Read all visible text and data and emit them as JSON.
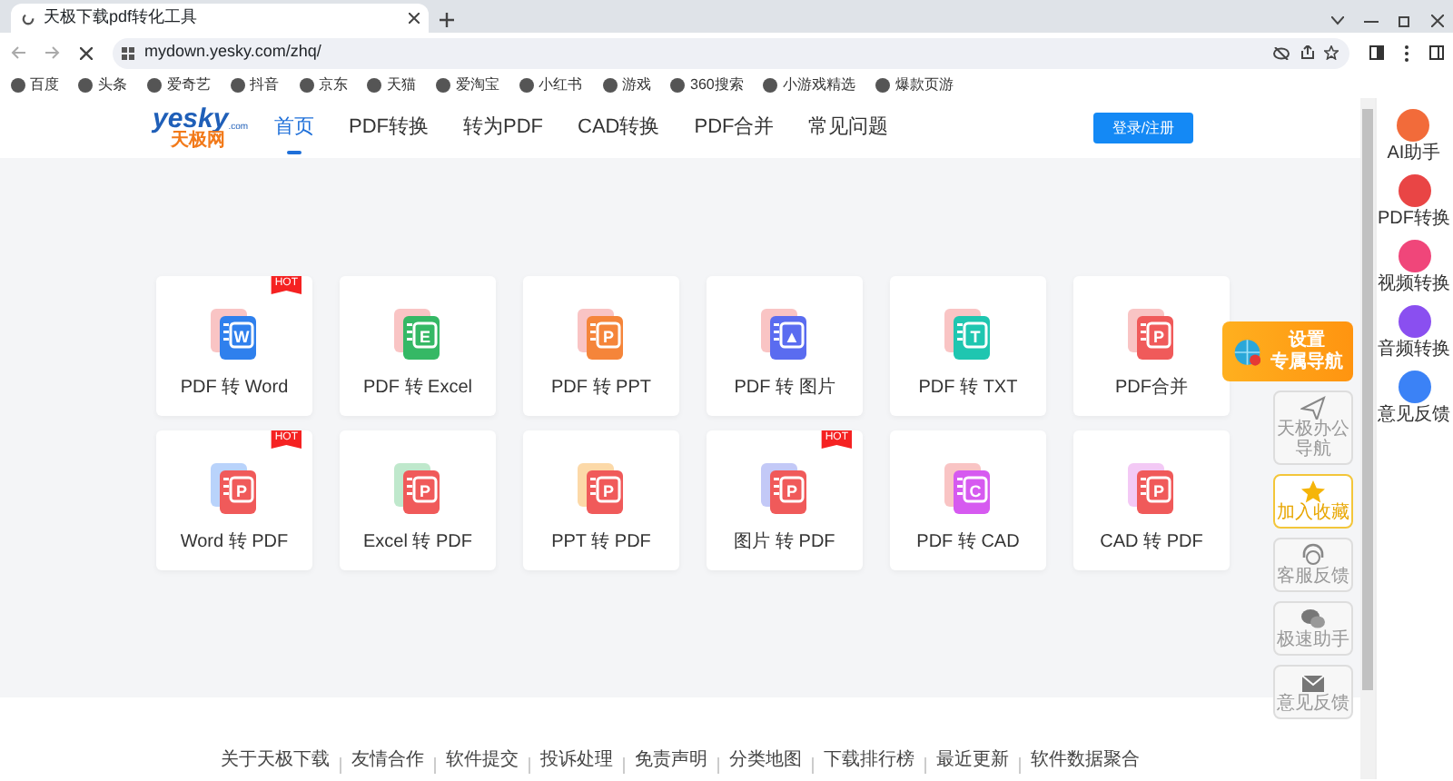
{
  "browser": {
    "tab_title": "天极下载pdf转化工具",
    "url": "mydown.yesky.com/zhq/",
    "bookmarks": [
      "百度",
      "头条",
      "爱奇艺",
      "抖音",
      "京东",
      "天猫",
      "爱淘宝",
      "小红书",
      "游戏",
      "360搜索",
      "小游戏精选",
      "爆款页游"
    ]
  },
  "header": {
    "logo": "yesky",
    "logo_cn": "天极网",
    "logo_dot": ".com",
    "nav": [
      {
        "label": "首页",
        "selected": true
      },
      {
        "label": "PDF转换",
        "selected": false
      },
      {
        "label": "转为PDF",
        "selected": false
      },
      {
        "label": "CAD转换",
        "selected": false
      },
      {
        "label": "PDF合并",
        "selected": false
      },
      {
        "label": "常见问题",
        "selected": false
      }
    ],
    "login_button": "登录/注册"
  },
  "cards": [
    {
      "label": "PDF 转 Word",
      "letter": "W",
      "layers": [
        {
          "color": "#f9c4c4"
        },
        {
          "color": "#2f80ed"
        }
      ],
      "badge": "HOT"
    },
    {
      "label": "PDF 转 Excel",
      "letter": "E",
      "layers": [
        {
          "color": "#f9c4c4"
        },
        {
          "color": "#35b865"
        }
      ]
    },
    {
      "label": "PDF 转 PPT",
      "letter": "P",
      "layers": [
        {
          "color": "#f9c4c4"
        },
        {
          "color": "#f5853a"
        }
      ]
    },
    {
      "label": "PDF 转 图片",
      "letter": "▲",
      "layers": [
        {
          "color": "#f9c4c4"
        },
        {
          "color": "#5a6cf0"
        }
      ]
    },
    {
      "label": "PDF 转 TXT",
      "letter": "T",
      "layers": [
        {
          "color": "#f9c4c4"
        },
        {
          "color": "#1fc6b0"
        }
      ]
    },
    {
      "label": "PDF合并",
      "letter": "P",
      "layers": [
        {
          "color": "#f9c4c4"
        },
        {
          "color": "#f05a5a"
        }
      ]
    },
    {
      "label": "Word 转 PDF",
      "letter": "P",
      "layers": [
        {
          "color": "#b9d3fb"
        },
        {
          "color": "#f05a5a"
        }
      ],
      "badge": "HOT"
    },
    {
      "label": "Excel 转 PDF",
      "letter": "P",
      "layers": [
        {
          "color": "#bfe8cc"
        },
        {
          "color": "#f05a5a"
        }
      ]
    },
    {
      "label": "PPT 转 PDF",
      "letter": "P",
      "layers": [
        {
          "color": "#fcd9a8"
        },
        {
          "color": "#f05a5a"
        }
      ]
    },
    {
      "label": "图片 转 PDF",
      "letter": "P",
      "layers": [
        {
          "color": "#c3c9f7"
        },
        {
          "color": "#f05a5a"
        }
      ],
      "badge": "HOT"
    },
    {
      "label": "PDF 转 CAD",
      "letter": "C",
      "layers": [
        {
          "color": "#f9c4c4"
        },
        {
          "color": "#d65af0"
        }
      ]
    },
    {
      "label": "CAD 转 PDF",
      "letter": "P",
      "layers": [
        {
          "color": "#f3c9f5"
        },
        {
          "color": "#f05a5a"
        }
      ]
    }
  ],
  "float_widget": {
    "promo": [
      "设置",
      "专属导航"
    ],
    "items": [
      {
        "label": "天极办公导航",
        "kind": "plane"
      },
      {
        "label": "加入收藏",
        "kind": "star"
      },
      {
        "label": "客服反馈",
        "kind": "headset"
      },
      {
        "label": "极速助手",
        "kind": "chat"
      },
      {
        "label": "意见反馈",
        "kind": "mail"
      }
    ]
  },
  "side_panel": [
    {
      "label": "AI助手",
      "color": "#f26b3a"
    },
    {
      "label": "PDF转换",
      "color": "#e94545"
    },
    {
      "label": "视频转换",
      "color": "#f0467a"
    },
    {
      "label": "音频转换",
      "color": "#8a4ff0"
    },
    {
      "label": "意见反馈",
      "color": "#3b82f6"
    }
  ],
  "footer_links": [
    "关于天极下载",
    "友情合作",
    "软件提交",
    "投诉处理",
    "免责声明",
    "分类地图",
    "下载排行榜",
    "最近更新",
    "软件数据聚合"
  ]
}
